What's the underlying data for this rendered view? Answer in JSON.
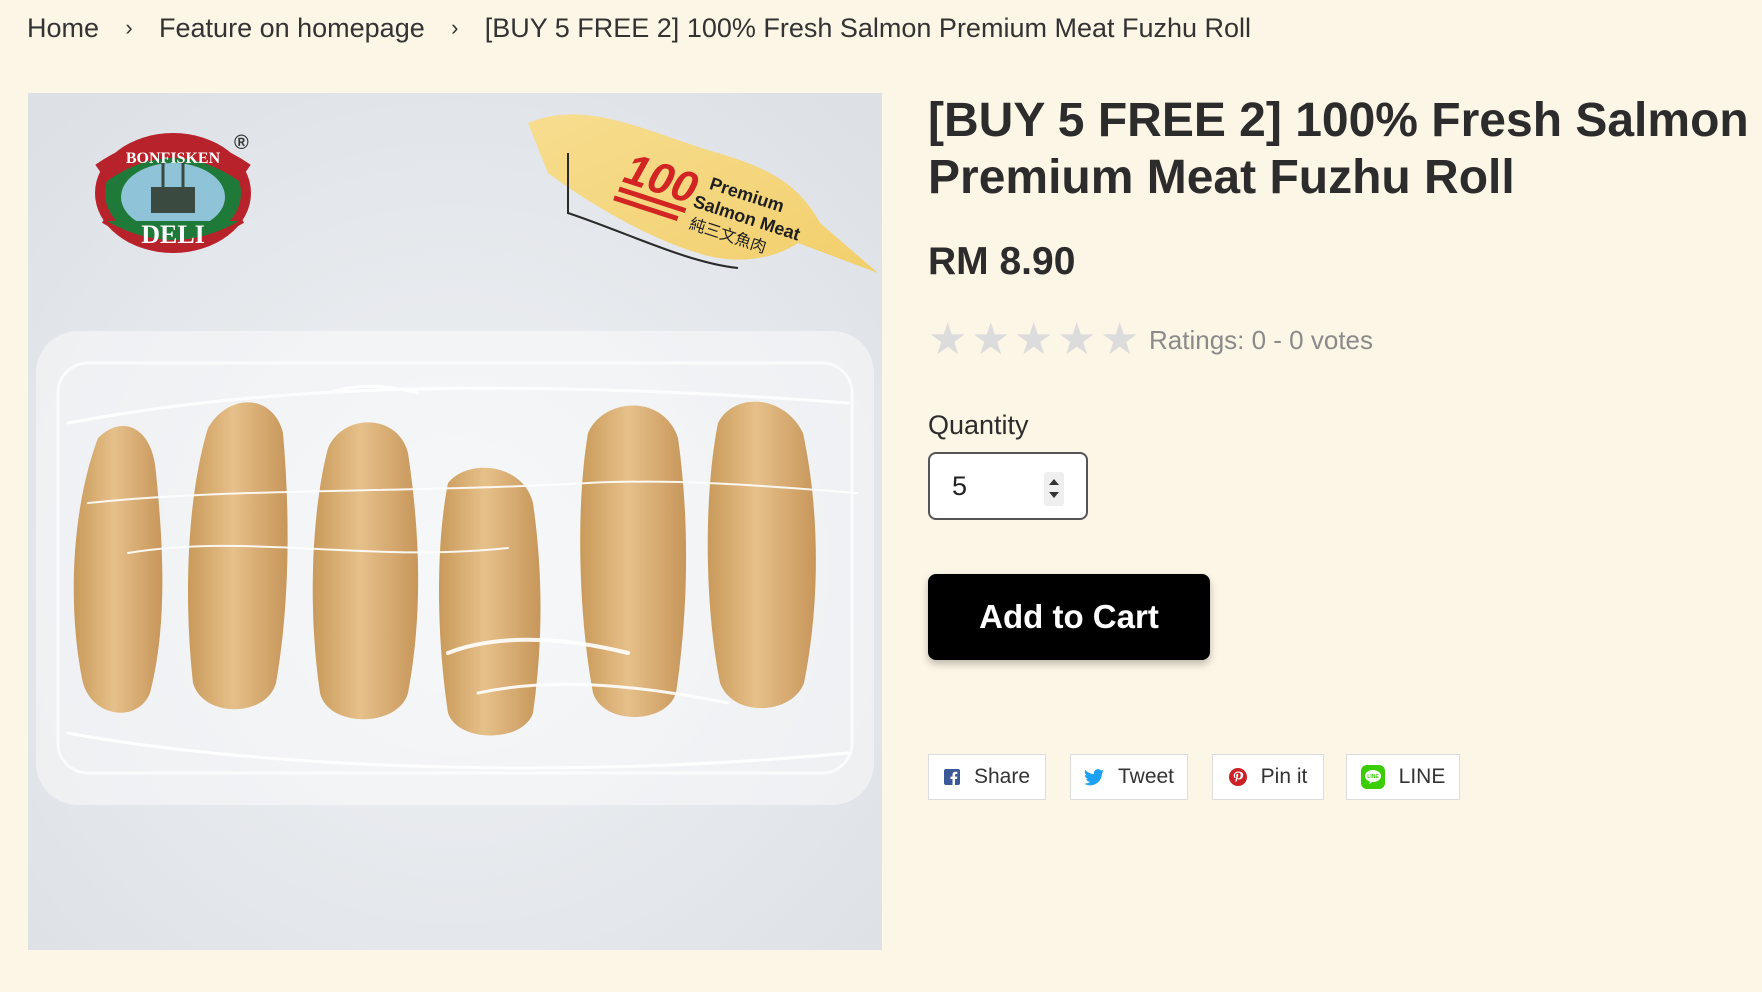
{
  "breadcrumb": {
    "items": [
      "Home",
      "Feature on homepage",
      "[BUY 5 FREE 2] 100% Fresh Salmon Premium Meat Fuzhu Roll"
    ],
    "separator": "›"
  },
  "image": {
    "brand_logo_top": "BONFISKEN",
    "brand_logo_bottom": "DELI",
    "registered_mark": "®",
    "banner_number": "100",
    "banner_line1": "Premium",
    "banner_line2": "Salmon Meat",
    "banner_line3": "純三文魚肉"
  },
  "product": {
    "title": "[BUY 5 FREE 2] 100% Fresh Salmon Premium Meat Fuzhu Roll",
    "price": "RM 8.90"
  },
  "rating": {
    "stars_total": 5,
    "stars_filled": 0,
    "text": "Ratings: 0 - 0 votes"
  },
  "quantity": {
    "label": "Quantity",
    "value": "5"
  },
  "cart": {
    "add_label": "Add to Cart"
  },
  "share": {
    "facebook_label": "Share",
    "twitter_label": "Tweet",
    "pinterest_label": "Pin it",
    "line_label": "LINE",
    "line_icon_text": "LINE"
  },
  "colors": {
    "background": "#fcf6e6",
    "cart_button": "#000000",
    "facebook": "#3b5998",
    "twitter": "#1da1f2",
    "pinterest": "#cb2027",
    "line": "#3acd01",
    "star_empty": "#dcdcdc"
  },
  "icons": [
    "chevron-right-icon",
    "star-icon",
    "spinner-up-icon",
    "spinner-down-icon",
    "facebook-icon",
    "twitter-icon",
    "pinterest-icon",
    "line-icon"
  ]
}
